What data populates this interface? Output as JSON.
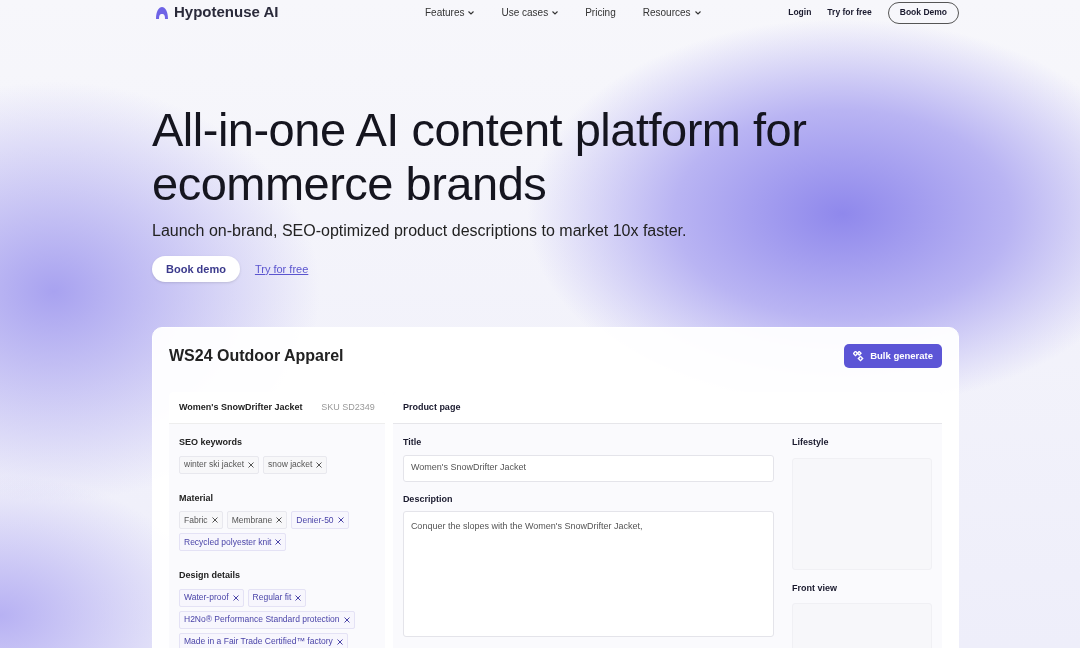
{
  "nav": {
    "brand": "Hypotenuse AI",
    "links": [
      {
        "label": "Features",
        "dropdown": true
      },
      {
        "label": "Use cases",
        "dropdown": true
      },
      {
        "label": "Pricing",
        "dropdown": false
      },
      {
        "label": "Resources",
        "dropdown": true
      }
    ],
    "login": "Login",
    "try": "Try for free",
    "demo": "Book Demo"
  },
  "hero": {
    "heading": "All-in-one AI content platform for ecommerce brands",
    "subheading": "Launch on-brand, SEO-optimized product descriptions to market 10x faster.",
    "primary": "Book demo",
    "secondary": "Try for free"
  },
  "app": {
    "title": "WS24 Outdoor Apparel",
    "action": "Bulk generate",
    "product": {
      "name": "Women's SnowDrifter Jacket",
      "sku": "SKU SD2349"
    },
    "groups": [
      {
        "label": "SEO keywords",
        "tags": [
          {
            "text": "winter ski jacket",
            "kind": "input"
          },
          {
            "text": "snow jacket",
            "kind": "input"
          }
        ]
      },
      {
        "label": "Material",
        "tags": [
          {
            "text": "Fabric",
            "kind": "input"
          },
          {
            "text": "Membrane",
            "kind": "input"
          },
          {
            "text": "Denier-50",
            "kind": "generated"
          },
          {
            "text": "Recycled polyester knit",
            "kind": "generated"
          }
        ]
      },
      {
        "label": "Design details",
        "tags": [
          {
            "text": "Water-proof",
            "kind": "generated"
          },
          {
            "text": "Regular fit",
            "kind": "generated"
          },
          {
            "text": "H2No® Performance Standard protection",
            "kind": "generated"
          },
          {
            "text": "Made in a Fair Trade Certified™ factory",
            "kind": "generated"
          }
        ]
      }
    ],
    "page": {
      "heading": "Product page",
      "title_label": "Title",
      "title_value": "Women's SnowDrifter Jacket",
      "description_label": "Description",
      "description_value": "Conquer the slopes with the Women's SnowDrifter Jacket,",
      "images": [
        {
          "label": "Lifestyle"
        },
        {
          "label": "Front view"
        }
      ]
    }
  }
}
